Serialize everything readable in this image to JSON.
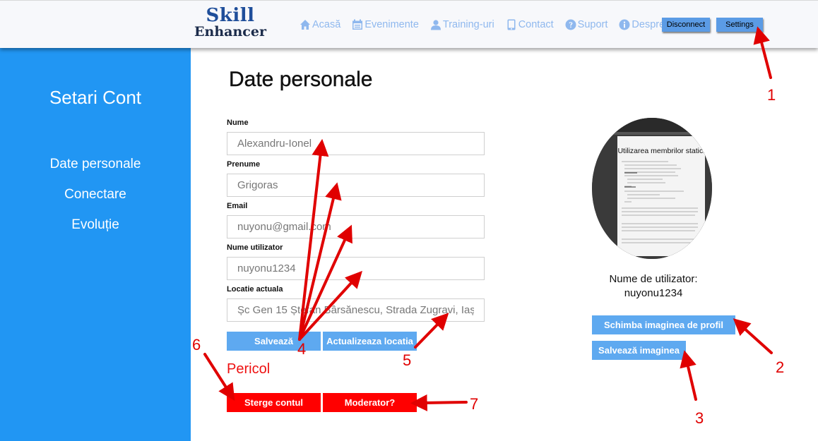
{
  "header": {
    "logo_line1": "Skill",
    "logo_line2": "Enhancer",
    "nav": [
      {
        "label": "Acasă",
        "icon": "home-icon"
      },
      {
        "label": "Evenimente",
        "icon": "calendar-icon"
      },
      {
        "label": "Training-uri",
        "icon": "user-icon"
      },
      {
        "label": "Contact",
        "icon": "phone-icon"
      },
      {
        "label": "Suport",
        "icon": "question-icon"
      },
      {
        "label": "Despre",
        "icon": "info-icon"
      }
    ],
    "disconnect_label": "Disconnect",
    "settings_label": "Settings"
  },
  "sidebar": {
    "title": "Setari Cont",
    "items": [
      {
        "label": "Date personale"
      },
      {
        "label": "Conectare"
      },
      {
        "label": "Evoluție"
      }
    ]
  },
  "form": {
    "title": "Date personale",
    "fields": [
      {
        "label": "Nume",
        "value": "Alexandru-Ionel"
      },
      {
        "label": "Prenume",
        "value": "Grigoras"
      },
      {
        "label": "Email",
        "value": "nuyonu@gmail.com"
      },
      {
        "label": "Nume utilizator",
        "value": "nuyonu1234"
      },
      {
        "label": "Locatie actuala",
        "value": "Șc Gen 15 Ștefan Bârsănescu, Strada Zugravi, Iaș"
      }
    ],
    "save_label": "Salvează",
    "update_location_label": "Actualizeaza locatia"
  },
  "danger": {
    "title": "Pericol",
    "delete_label": "Sterge contul",
    "moderator_label": "Moderator?"
  },
  "profile": {
    "avatar_slide_title": "Utilizarea membrilor statici",
    "username_caption": "Nume de utilizator:",
    "username": "nuyonu1234",
    "change_image_label": "Schimba imaginea de profil",
    "save_image_label": "Salvează imaginea"
  },
  "annotations": [
    "1",
    "2",
    "3",
    "4",
    "5",
    "6",
    "7"
  ],
  "colors": {
    "sidebar": "#2196f3",
    "nav_text": "#8fb8ee",
    "button_blue": "#5ea9f0",
    "danger": "#ff0000",
    "annotation": "#e00000"
  }
}
